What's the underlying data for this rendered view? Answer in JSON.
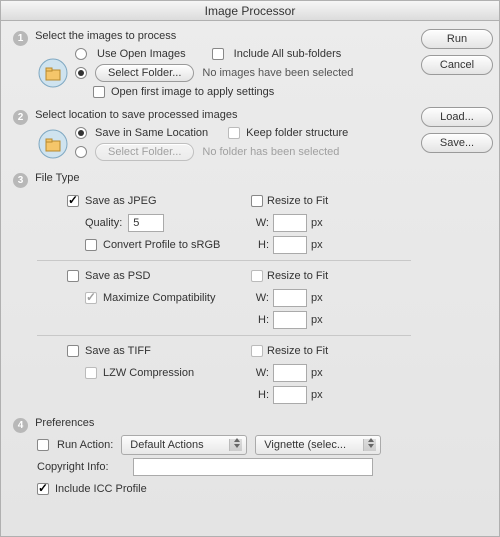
{
  "title": "Image Processor",
  "buttons": {
    "run": "Run",
    "cancel": "Cancel",
    "load": "Load...",
    "save": "Save..."
  },
  "step1": {
    "num": "1",
    "heading": "Select the images to process",
    "use_open": "Use Open Images",
    "include_sub": "Include All sub-folders",
    "select_folder": "Select Folder...",
    "no_images": "No images have been selected",
    "open_first": "Open first image to apply settings"
  },
  "step2": {
    "num": "2",
    "heading": "Select location to save processed images",
    "same_loc": "Save in Same Location",
    "keep_struct": "Keep folder structure",
    "select_folder": "Select Folder...",
    "no_folder": "No folder has been selected"
  },
  "step3": {
    "num": "3",
    "heading": "File Type",
    "jpeg": {
      "save_as": "Save as JPEG",
      "resize": "Resize to Fit",
      "quality_label": "Quality:",
      "quality_value": "5",
      "convert": "Convert Profile to sRGB",
      "w": "W:",
      "h": "H:",
      "px": "px"
    },
    "psd": {
      "save_as": "Save as PSD",
      "resize": "Resize to Fit",
      "max_compat": "Maximize Compatibility",
      "w": "W:",
      "h": "H:",
      "px": "px"
    },
    "tiff": {
      "save_as": "Save as TIFF",
      "resize": "Resize to Fit",
      "lzw": "LZW Compression",
      "w": "W:",
      "h": "H:",
      "px": "px"
    }
  },
  "step4": {
    "num": "4",
    "heading": "Preferences",
    "run_action": "Run Action:",
    "action_set": "Default Actions",
    "action_name": "Vignette (selec...",
    "copyright_label": "Copyright Info:",
    "copyright_value": "",
    "icc": "Include ICC Profile"
  }
}
